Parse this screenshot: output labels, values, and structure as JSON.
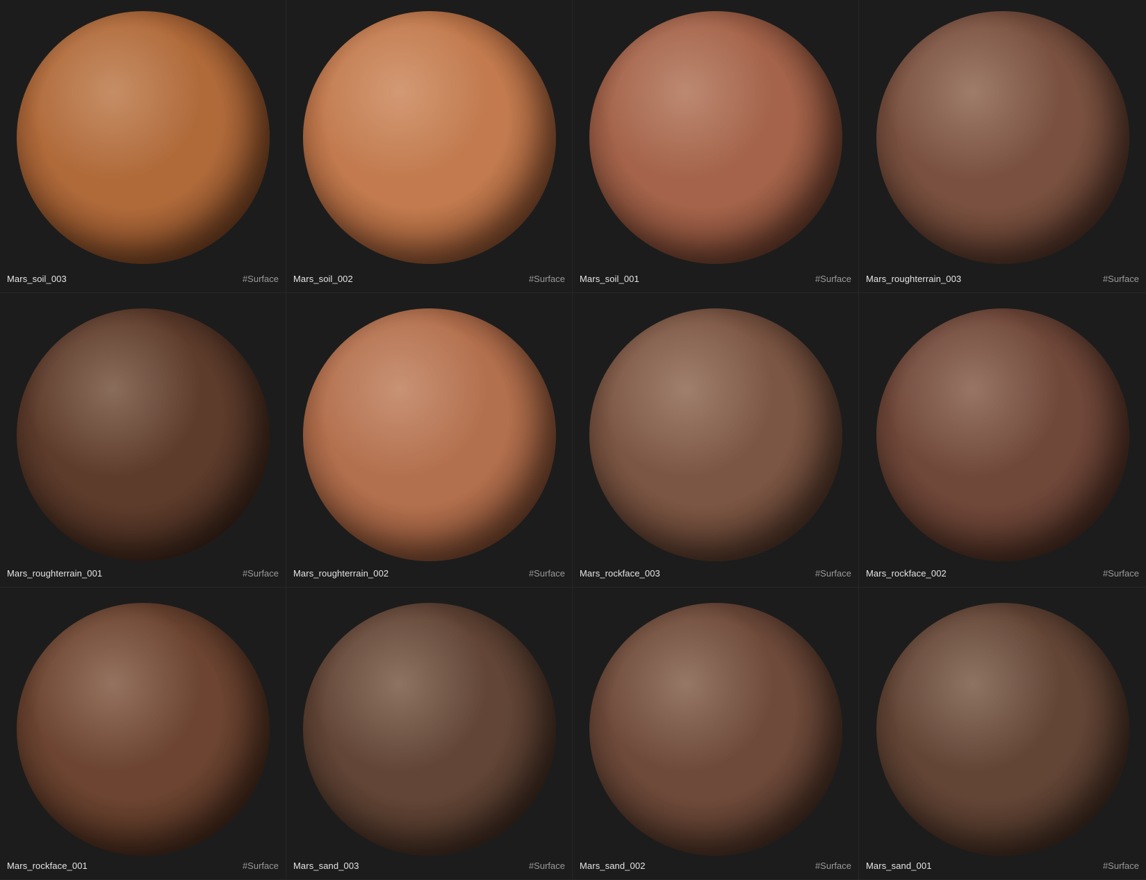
{
  "materials": [
    {
      "name": "Mars_soil_003",
      "tag": "#Surface",
      "color": "#b06a3a",
      "dark": "#4a2410"
    },
    {
      "name": "Mars_soil_002",
      "tag": "#Surface",
      "color": "#c27a4e",
      "dark": "#5a2b14"
    },
    {
      "name": "Mars_soil_001",
      "tag": "#Surface",
      "color": "#a4634a",
      "dark": "#3e1f14"
    },
    {
      "name": "Mars_roughterrain_003",
      "tag": "#Surface",
      "color": "#7a5140",
      "dark": "#2e1a12"
    },
    {
      "name": "Mars_roughterrain_001",
      "tag": "#Surface",
      "color": "#5e3c2c",
      "dark": "#22140c"
    },
    {
      "name": "Mars_roughterrain_002",
      "tag": "#Surface",
      "color": "#b3704e",
      "dark": "#4a2614"
    },
    {
      "name": "Mars_rockface_003",
      "tag": "#Surface",
      "color": "#7c5644",
      "dark": "#2c1a10"
    },
    {
      "name": "Mars_rockface_002",
      "tag": "#Surface",
      "color": "#70483a",
      "dark": "#2a160e"
    },
    {
      "name": "Mars_rockface_001",
      "tag": "#Surface",
      "color": "#6c4431",
      "dark": "#26140a"
    },
    {
      "name": "Mars_sand_003",
      "tag": "#Surface",
      "color": "#624536",
      "dark": "#241710"
    },
    {
      "name": "Mars_sand_002",
      "tag": "#Surface",
      "color": "#6e4a3a",
      "dark": "#271810"
    },
    {
      "name": "Mars_sand_001",
      "tag": "#Surface",
      "color": "#634536",
      "dark": "#24170f"
    }
  ]
}
